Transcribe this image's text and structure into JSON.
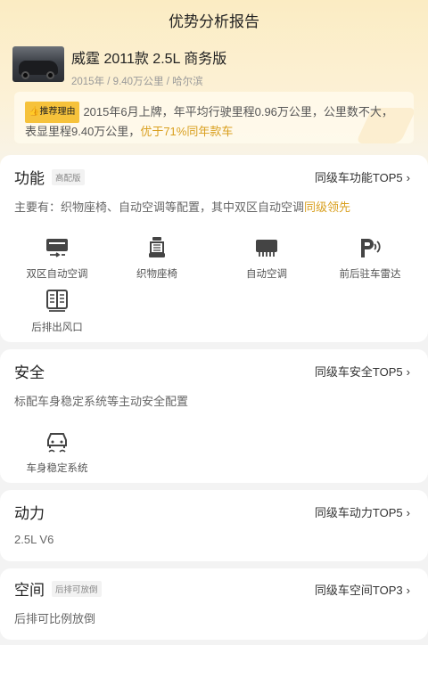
{
  "header": {
    "title": "优势分析报告"
  },
  "car": {
    "name": "威霆 2011款 2.5L 商务版",
    "meta": "2015年 / 9.40万公里 / 哈尔滨"
  },
  "reason": {
    "badge": "推荐理由",
    "text_part1": "2015年6月上牌，年平均行驶里程0.96万公里，公里数不大，表显里程9.40万公里，",
    "text_highlight": "优于71%同年款车"
  },
  "sections": {
    "function": {
      "title": "功能",
      "badge": "高配版",
      "link": "同级车功能TOP5",
      "desc_prefix": "主要有：织物座椅、自动空调等配置，其中双区自动空调",
      "desc_highlight": "同级领先",
      "features": [
        {
          "icon": "dual-zone-ac-icon",
          "label": "双区自动空调"
        },
        {
          "icon": "fabric-seat-icon",
          "label": "织物座椅"
        },
        {
          "icon": "auto-ac-icon",
          "label": "自动空调"
        },
        {
          "icon": "parking-radar-icon",
          "label": "前后驻车雷达"
        },
        {
          "icon": "rear-vent-icon",
          "label": "后排出风口"
        }
      ]
    },
    "safety": {
      "title": "安全",
      "link": "同级车安全TOP5",
      "desc": "标配车身稳定系统等主动安全配置",
      "features": [
        {
          "icon": "stability-control-icon",
          "label": "车身稳定系统"
        }
      ]
    },
    "power": {
      "title": "动力",
      "link": "同级车动力TOP5",
      "desc": "2.5L V6"
    },
    "space": {
      "title": "空间",
      "badge": "后排可放倒",
      "link": "同级车空间TOP3",
      "desc": "后排可比例放倒"
    }
  },
  "colors": {
    "highlight": "#d9a020",
    "badge_yellow": "#f6c23b"
  }
}
